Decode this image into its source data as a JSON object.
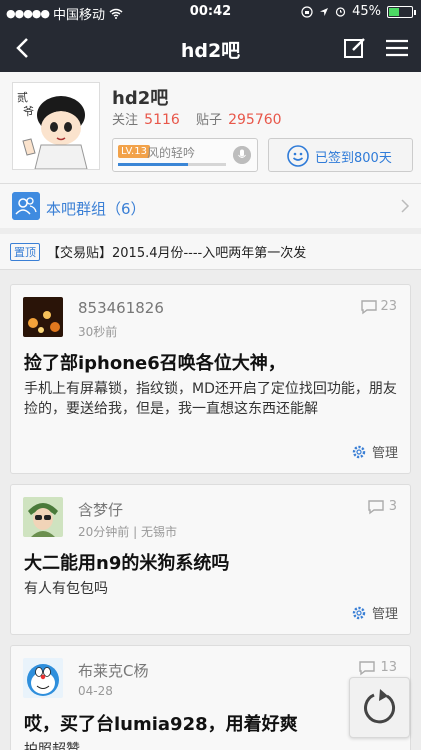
{
  "status_bar": {
    "carrier": "中国移动",
    "time": "00:42",
    "battery": "45%",
    "battery_level": 0.45
  },
  "nav": {
    "title": "hd2吧"
  },
  "forum": {
    "name": "hd2吧",
    "follow_label": "关注",
    "follow_count": "5116",
    "posts_label": "贴子",
    "posts_count": "295760",
    "level_badge": "LV.13",
    "level_name": "风的轻吟",
    "level_progress": 0.65,
    "signed_label": "已签到800天"
  },
  "group": {
    "label": "本吧群组（6）"
  },
  "top_post": {
    "badge": "置顶",
    "title": "【交易贴】2015.4月份----入吧两年第一次发"
  },
  "posts": [
    {
      "user": "853461826",
      "meta": "30秒前",
      "comments": "23",
      "title": "捡了部iphone6召唤各位大神，",
      "text": "手机上有屏幕锁，指纹锁，MD还开启了定位找回功能，朋友捡的，要送给我，但是，我一直想这东西还能解",
      "manage": "管理"
    },
    {
      "user": "含梦仔",
      "meta": "20分钟前 | 无锡市",
      "comments": "3",
      "title": "大二能用n9的米狗系统吗",
      "text": "有人有包包吗",
      "manage": "管理"
    },
    {
      "user": "布莱克C杨",
      "meta": "04-28",
      "comments": "13",
      "title": "哎，买了台lumia928，用着好爽",
      "text": "拍照超赞"
    }
  ],
  "colors": {
    "nav_bg": "#262a33",
    "accent_blue": "#3a7fd5",
    "accent_red": "#e8574a"
  }
}
